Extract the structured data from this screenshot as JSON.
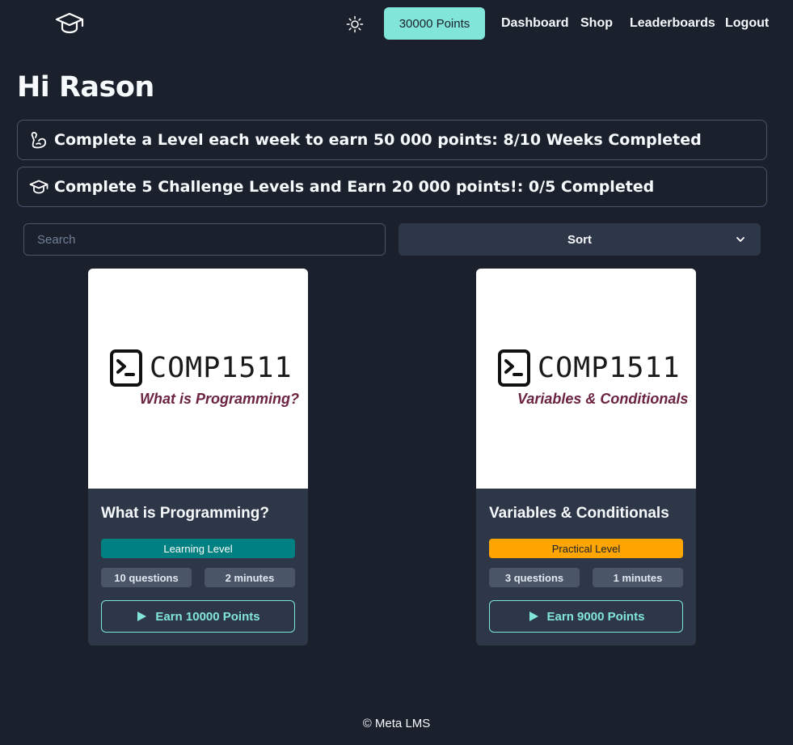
{
  "nav": {
    "logo_icon": "graduation-cap-icon",
    "theme_icon": "sun-icon",
    "points": "30000 Points",
    "links": [
      "Dashboard",
      "Shop",
      "Leaderboards",
      "Logout"
    ]
  },
  "greeting": "Hi Rason",
  "quests": [
    {
      "icon": "flexed-bicep-icon",
      "text": "Complete a Level each week to earn 50 000 points: 8/10 Weeks Completed"
    },
    {
      "icon": "graduation-cap-icon",
      "text": "Complete 5 Challenge Levels and Earn 20 000 points!: 0/5 Completed"
    }
  ],
  "search": {
    "placeholder": "Search",
    "value": ""
  },
  "sort": {
    "label": "Sort"
  },
  "cards": [
    {
      "image_code": "COMP1511",
      "image_subtitle": "What is Programming?",
      "title": "What is Programming?",
      "level": "Learning Level",
      "level_color": "#008080",
      "questions": "10 questions",
      "duration": "2 minutes",
      "action": "Earn 10000 Points"
    },
    {
      "image_code": "COMP1511",
      "image_subtitle": "Variables & Conditionals",
      "title": "Variables & Conditionals",
      "level": "Practical Level",
      "level_color": "#ffa500",
      "questions": "3 questions",
      "duration": "1 minutes",
      "action": "Earn 9000 Points"
    }
  ],
  "footer": "© Meta LMS",
  "colors": {
    "background": "#1a202c",
    "card": "#2d3748",
    "accent": "#81e6d9"
  }
}
